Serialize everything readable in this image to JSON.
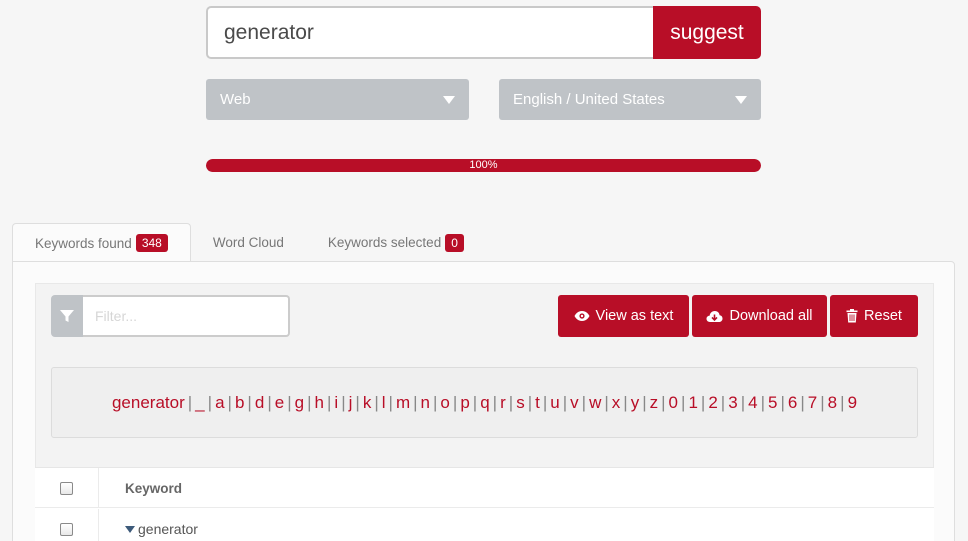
{
  "search": {
    "value": "generator",
    "button_label": "suggest"
  },
  "selects": {
    "source": "Web",
    "language": "English / United States"
  },
  "progress": {
    "percent": 100,
    "label": "100%"
  },
  "tabs": [
    {
      "label": "Keywords found",
      "badge": "348"
    },
    {
      "label": "Word Cloud"
    },
    {
      "label": "Keywords selected",
      "badge": "0"
    }
  ],
  "toolbar": {
    "filter_placeholder": "Filter...",
    "view_as_text": "View as text",
    "download_all": "Download all",
    "reset": "Reset"
  },
  "alphabet": [
    "generator",
    "_",
    "a",
    "b",
    "d",
    "e",
    "g",
    "h",
    "i",
    "j",
    "k",
    "l",
    "m",
    "n",
    "o",
    "p",
    "q",
    "r",
    "s",
    "t",
    "u",
    "v",
    "w",
    "x",
    "y",
    "z",
    "0",
    "1",
    "2",
    "3",
    "4",
    "5",
    "6",
    "7",
    "8",
    "9"
  ],
  "table": {
    "header": "Keyword",
    "rows": [
      "generator"
    ]
  },
  "colors": {
    "accent": "#b80e27",
    "select_bg": "#bfc3c7"
  }
}
